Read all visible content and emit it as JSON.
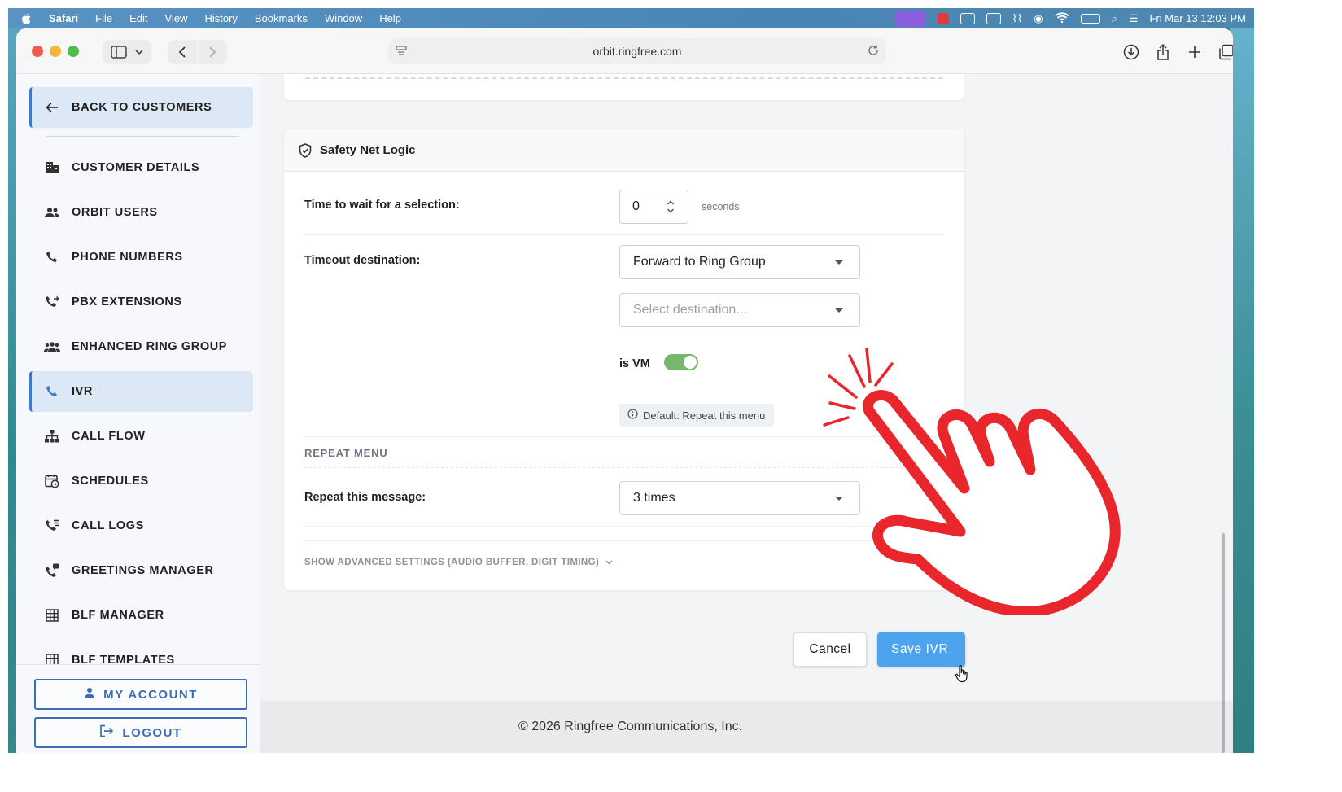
{
  "menubar": {
    "app": "Safari",
    "items": [
      "File",
      "Edit",
      "View",
      "History",
      "Bookmarks",
      "Window",
      "Help"
    ],
    "clock": "Fri Mar 13  12:03 PM"
  },
  "browser": {
    "url": "orbit.ringfree.com"
  },
  "sidebar": {
    "back": "BACK TO CUSTOMERS",
    "items": [
      {
        "label": "CUSTOMER DETAILS",
        "icon": "building-icon"
      },
      {
        "label": "ORBIT USERS",
        "icon": "users-icon"
      },
      {
        "label": "PHONE NUMBERS",
        "icon": "phone-icon"
      },
      {
        "label": "PBX EXTENSIONS",
        "icon": "phone-forward-icon"
      },
      {
        "label": "ENHANCED RING GROUP",
        "icon": "group-icon"
      },
      {
        "label": "IVR",
        "icon": "phone-icon",
        "active": true
      },
      {
        "label": "CALL FLOW",
        "icon": "sitemap-icon"
      },
      {
        "label": "SCHEDULES",
        "icon": "calendar-clock-icon"
      },
      {
        "label": "CALL LOGS",
        "icon": "phone-log-icon"
      },
      {
        "label": "GREETINGS MANAGER",
        "icon": "phone-message-icon"
      },
      {
        "label": "BLF MANAGER",
        "icon": "grid-icon"
      },
      {
        "label": "BLF TEMPLATES",
        "icon": "grid-icon"
      }
    ],
    "my_account": "MY ACCOUNT",
    "logout": "LOGOUT"
  },
  "safety_net": {
    "title": "Safety Net Logic",
    "wait_label": "Time to wait for a selection:",
    "wait_value": "0",
    "wait_unit": "seconds",
    "timeout_label": "Timeout destination:",
    "timeout_value": "Forward to Ring Group",
    "destination_placeholder": "Select destination...",
    "is_vm_label": "is VM",
    "is_vm_on": true,
    "default_hint": "Default: Repeat this menu",
    "repeat_section": "REPEAT MENU",
    "repeat_label": "Repeat this message:",
    "repeat_value": "3 times",
    "advanced_link": "SHOW ADVANCED SETTINGS (AUDIO BUFFER, DIGIT TIMING)"
  },
  "actions": {
    "cancel": "Cancel",
    "save": "Save IVR"
  },
  "footer": "© 2026 Ringfree Communications, Inc.",
  "colors": {
    "accent": "#3f79c8",
    "save_button": "#4da3ee",
    "toggle_on": "#77b66b",
    "hand_outline": "#e8262b"
  }
}
